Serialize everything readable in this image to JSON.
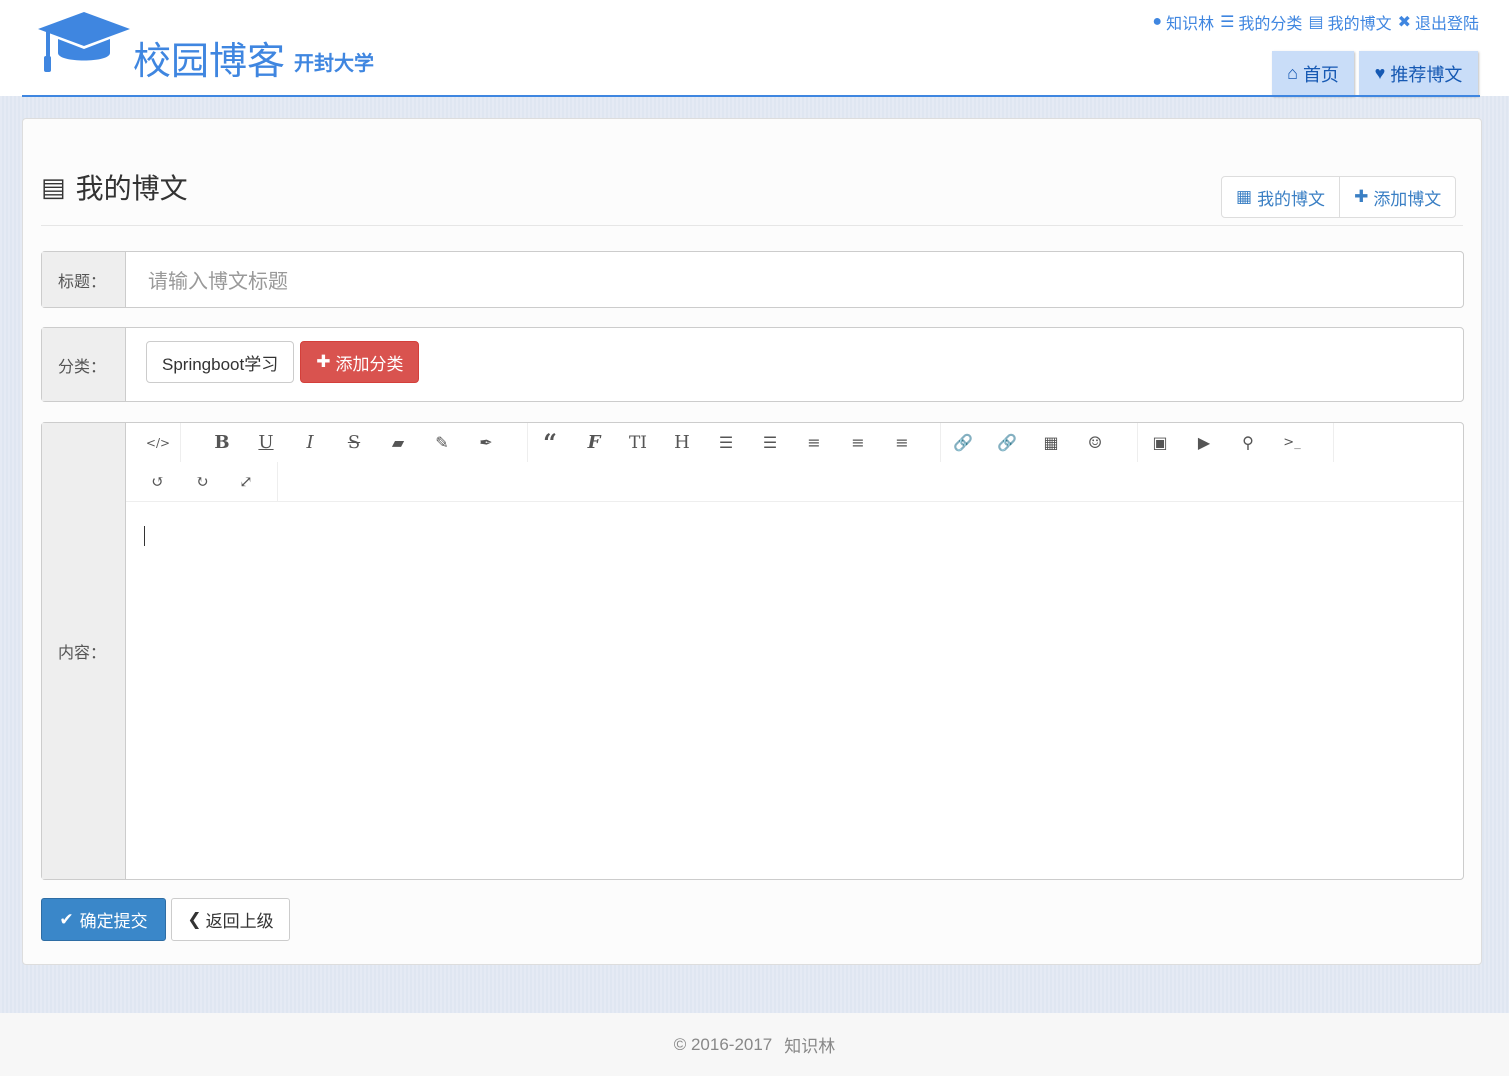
{
  "header": {
    "brand": "校园博客",
    "school": "开封大学",
    "topnav": [
      {
        "icon": "user-icon",
        "label": "知识林"
      },
      {
        "icon": "list-icon",
        "label": "我的分类"
      },
      {
        "icon": "newspaper-icon",
        "label": "我的博文"
      },
      {
        "icon": "close-circle-icon",
        "label": "退出登陆"
      }
    ],
    "nav": [
      {
        "icon": "home-icon",
        "label": "首页"
      },
      {
        "icon": "heart-icon",
        "label": "推荐博文"
      }
    ]
  },
  "page": {
    "title": "我的博文",
    "actions": {
      "list": "我的博文",
      "add": "添加博文"
    }
  },
  "form": {
    "title_label": "标题：",
    "title_placeholder": "请输入博文标题",
    "category_label": "分类：",
    "category_selected": "Springboot学习",
    "add_category": "添加分类",
    "content_label": "内容：",
    "content_value": "",
    "submit": "确定提交",
    "back": "返回上级"
  },
  "editor": {
    "toolbar": [
      "code",
      "bold",
      "underline",
      "italic",
      "strikethrough",
      "eraser",
      "pencil",
      "brush",
      "quote",
      "font",
      "font-size",
      "heading",
      "unordered-list",
      "ordered-list",
      "align-left",
      "align-center",
      "align-right",
      "link",
      "unlink",
      "table",
      "emoji",
      "image",
      "video",
      "map-marker",
      "terminal",
      "undo",
      "redo",
      "fullscreen"
    ]
  },
  "footer": {
    "copyright": "© 2016-2017",
    "author": "知识林"
  },
  "colors": {
    "brand": "#3f86e0",
    "danger": "#d9534f",
    "primary": "#3a87c9"
  }
}
